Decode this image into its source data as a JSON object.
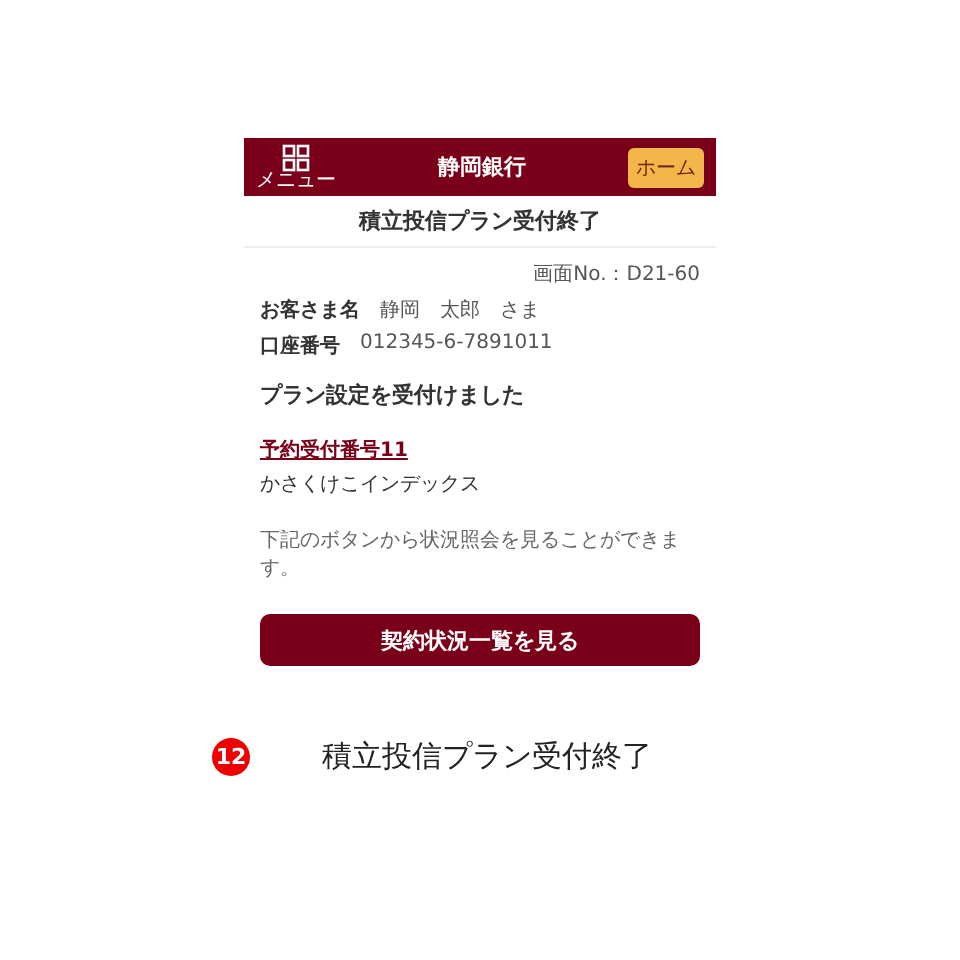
{
  "header": {
    "menu_label": "メニュー",
    "title": "静岡銀行",
    "home_button": "ホーム"
  },
  "page_title": "積立投信プラン受付終了",
  "screen_no": "画面No.：D21-60",
  "customer": {
    "label": "お客さま名",
    "name": "静岡　太郎",
    "honorific": "さま"
  },
  "account": {
    "label": "口座番号",
    "number": "012345-6-7891011"
  },
  "message": "プラン設定を受付けました",
  "reservation": {
    "link": "予約受付番号11",
    "fund": "かさくけこインデックス"
  },
  "note": "下記のボタンから状況照会を見ることができます。",
  "action_button": "契約状況一覧を見る",
  "caption": {
    "step": "12",
    "text": "積立投信プラン受付終了"
  }
}
